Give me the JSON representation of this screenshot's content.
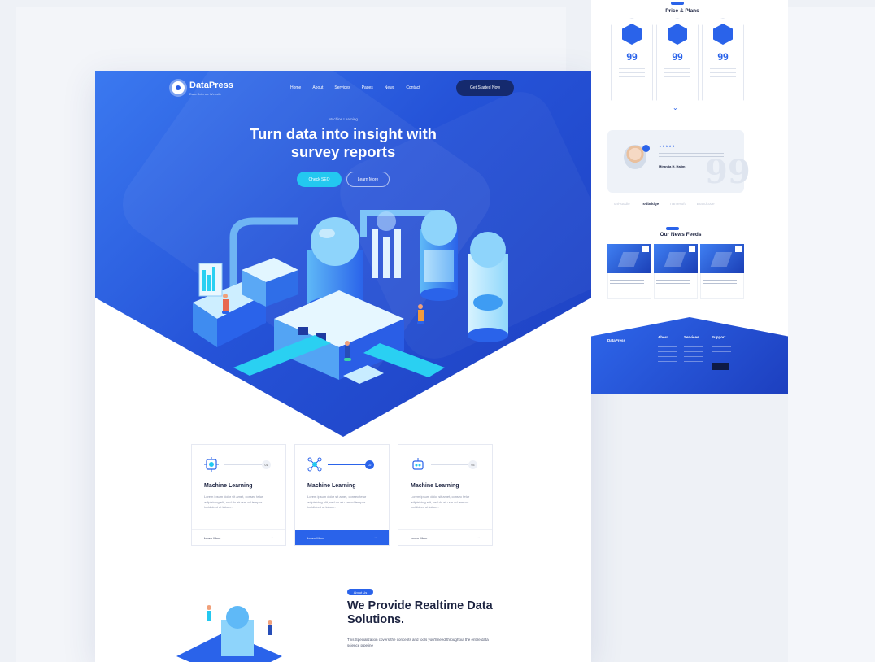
{
  "hero": {
    "logo": {
      "name": "DataPress",
      "tagline": "Data Science Website"
    },
    "nav": [
      "Home",
      "About",
      "Services",
      "Pages",
      "News",
      "Contact"
    ],
    "cta": "Get Started Now",
    "eyebrow": "Machine Learning",
    "title": "Turn data into insight with survey reports",
    "primary_button": "Check SEO",
    "secondary_button": "Learn More"
  },
  "features": [
    {
      "title": "Machine Learning",
      "text": "Lorem ipsum dolor sit amet, consec tetur adipisicing elit, sed do eiu sm od tempor incididunt ut labore.",
      "number": "01",
      "link": "Learn More"
    },
    {
      "title": "Machine Learning",
      "text": "Lorem ipsum dolor sit amet, consec tetur adipisicing elit, sed do eiu sm od tempor incididunt ut labore.",
      "number": "02",
      "link": "Learn More"
    },
    {
      "title": "Machine Learning",
      "text": "Lorem ipsum dolor sit amet, consec tetur adipisicing elit, sed do eiu sm od tempor incididunt ut labore.",
      "number": "03",
      "link": "Learn More"
    }
  ],
  "about": {
    "badge": "About Us",
    "title": "We Provide Realtime Data Solutions.",
    "text": "This Specialization covers the concepts and tools you'll need throughout the entire data science pipeline"
  },
  "plans": {
    "title": "Price & Plans",
    "prices": [
      "99",
      "99",
      "99"
    ]
  },
  "testimonial": {
    "stars": "★★★★★",
    "name": "Miranda H. Halim",
    "quote_mark": "99"
  },
  "brands": [
    "uni-studio",
    "Todbridge",
    "namesoft",
    "Brandcode"
  ],
  "news": {
    "title": "Our News Feeds"
  },
  "footer": {
    "logo": "DataPress",
    "columns": [
      "About",
      "Services",
      "Support"
    ]
  },
  "colors": {
    "accent": "#2a63ea",
    "hero_start": "#3b79f0",
    "hero_end": "#1e3fc0",
    "cyan_button": "#23c8f0",
    "navy": "#152a6e"
  }
}
